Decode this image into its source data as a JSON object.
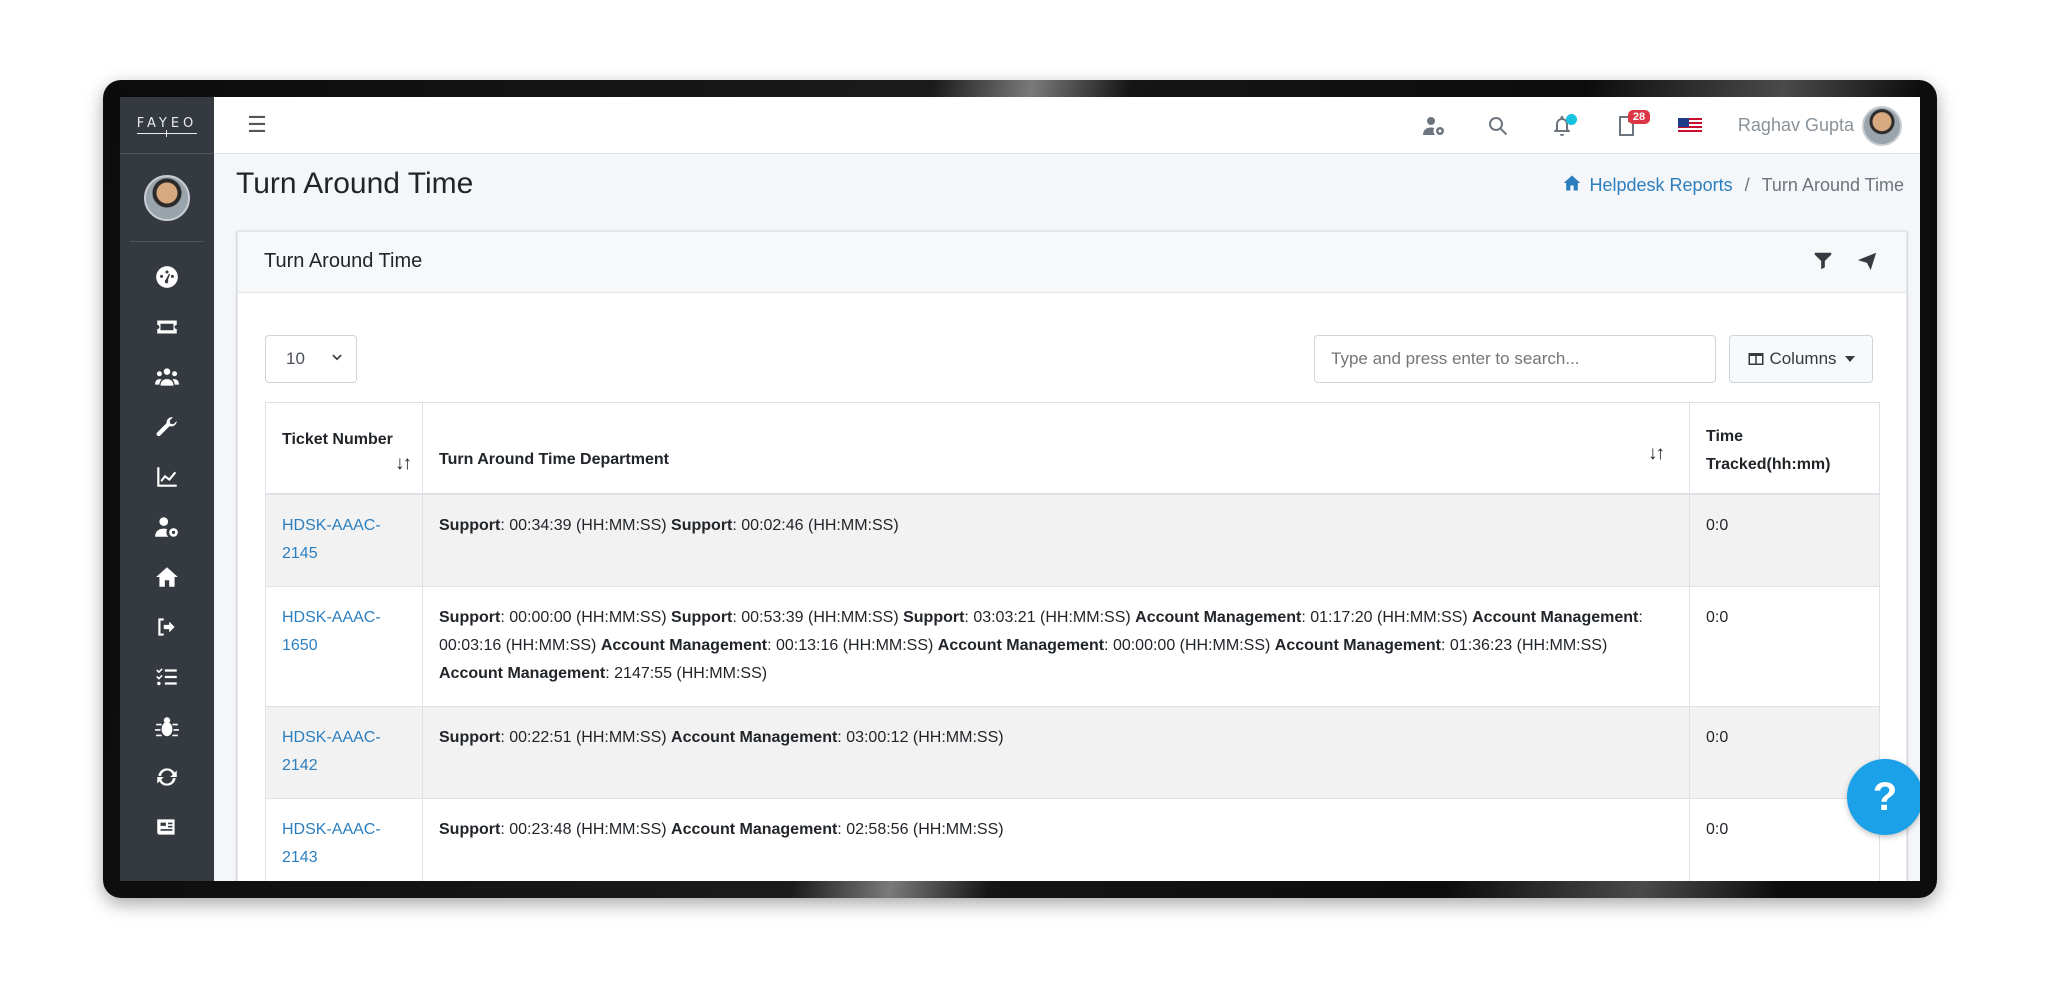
{
  "brand": {
    "logo_text": "FAYEO"
  },
  "topbar": {
    "user_name": "Raghav Gupta",
    "notification_badge": "28"
  },
  "sidebar": {
    "icons": [
      "dashboard-icon",
      "ticket-icon",
      "users-icon",
      "wrench-icon",
      "chart-icon",
      "user-gear-icon",
      "home-icon",
      "sign-out-icon",
      "tasks-icon",
      "bug-icon",
      "sync-icon",
      "newspaper-icon"
    ]
  },
  "page": {
    "title": "Turn Around Time",
    "breadcrumb": {
      "parent": "Helpdesk Reports",
      "separator": "/",
      "current": "Turn Around Time"
    }
  },
  "card": {
    "title": "Turn Around Time",
    "page_length": "10",
    "search_placeholder": "Type and press enter to search...",
    "columns_label": "Columns"
  },
  "table": {
    "headers": {
      "ticket": "Ticket Number",
      "dept": "Turn Around Time Department",
      "time": "Time Tracked(hh:mm)"
    },
    "rows": [
      {
        "ticket_line1": "HDSK-AAAC-",
        "ticket_line2": "2145",
        "entries": [
          {
            "dept": "Support",
            "time": ": 00:34:39 (HH:MM:SS) "
          },
          {
            "dept": "Support",
            "time": ": 00:02:46 (HH:MM:SS)"
          }
        ],
        "tracked": "0:0"
      },
      {
        "ticket_line1": "HDSK-AAAC-",
        "ticket_line2": "1650",
        "entries": [
          {
            "dept": "Support",
            "time": ": 00:00:00 (HH:MM:SS) "
          },
          {
            "dept": "Support",
            "time": ": 00:53:39 (HH:MM:SS) "
          },
          {
            "dept": "Support",
            "time": ": 03:03:21 (HH:MM:SS) "
          },
          {
            "dept": "Account Management",
            "time": ": 01:17:20 (HH:MM:SS) "
          },
          {
            "dept": "Account Management",
            "time": ": 00:03:16 (HH:MM:SS) "
          },
          {
            "dept": "Account Management",
            "time": ": 00:13:16 (HH:MM:SS) "
          },
          {
            "dept": "Account Management",
            "time": ": 00:00:00 (HH:MM:SS) "
          },
          {
            "dept": "Account Management",
            "time": ": 01:36:23 (HH:MM:SS) "
          },
          {
            "dept": "Account Management",
            "time": ": 2147:55 (HH:MM:SS)"
          }
        ],
        "tracked": "0:0"
      },
      {
        "ticket_line1": "HDSK-AAAC-",
        "ticket_line2": "2142",
        "entries": [
          {
            "dept": "Support",
            "time": ": 00:22:51 (HH:MM:SS) "
          },
          {
            "dept": "Account Management",
            "time": ": 03:00:12 (HH:MM:SS)"
          }
        ],
        "tracked": "0:0"
      },
      {
        "ticket_line1": "HDSK-AAAC-",
        "ticket_line2": "2143",
        "entries": [
          {
            "dept": "Support",
            "time": ": 00:23:48 (HH:MM:SS) "
          },
          {
            "dept": "Account Management",
            "time": ": 02:58:56 (HH:MM:SS)"
          }
        ],
        "tracked": "0:0"
      }
    ]
  },
  "help": {
    "label": "?"
  }
}
